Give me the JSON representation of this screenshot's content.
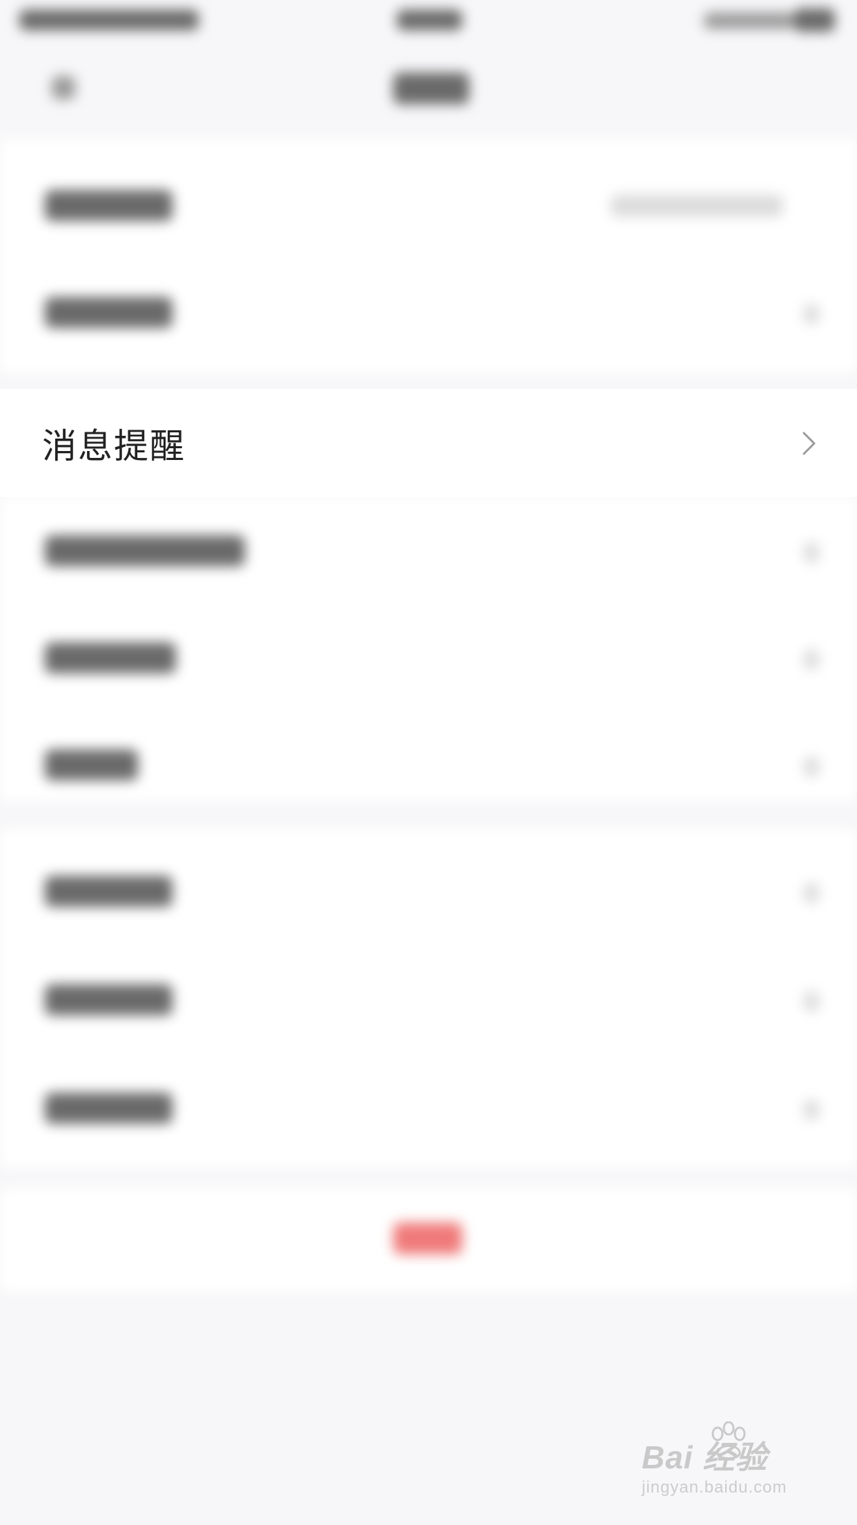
{
  "settings_list": {
    "visible_item": {
      "label": "消息提醒",
      "icon": "chevron-right-icon"
    }
  },
  "watermark": {
    "brand": "Bai   经验",
    "url": "jingyan.baidu.com"
  },
  "colors": {
    "background": "#f7f7f9",
    "row_background": "#ffffff",
    "label_text": "#222222",
    "chevron": "#9a9a9a",
    "accent_red": "#f07a7a"
  }
}
